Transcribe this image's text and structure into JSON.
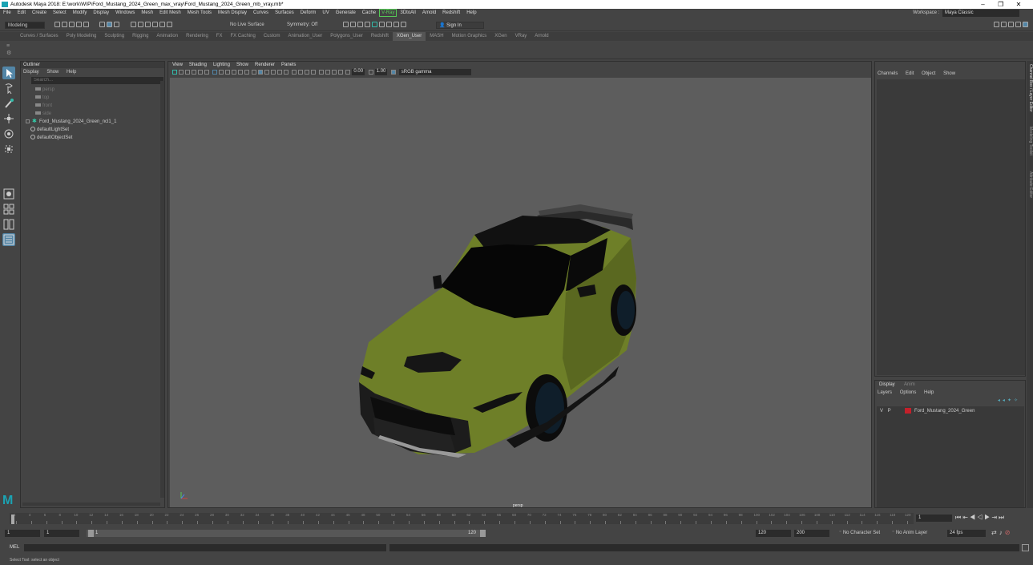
{
  "window": {
    "title": "Autodesk Maya 2018: E:\\work\\WIP\\Ford_Mustang_2024_Green_max_vray\\Ford_Mustang_2024_Green_mb_vray.mb*",
    "minimize": "–",
    "maximize": "❐",
    "close": "✕"
  },
  "menubar": {
    "items": [
      "File",
      "Edit",
      "Create",
      "Select",
      "Modify",
      "Display",
      "Windows",
      "Mesh",
      "Edit Mesh",
      "Mesh Tools",
      "Mesh Display",
      "Curves",
      "Surfaces",
      "Deform",
      "UV",
      "Generate",
      "Cache",
      "V-Ray",
      "3DtoAll",
      "Arnold",
      "Redshift",
      "Help"
    ],
    "workspace_label": "Workspace :",
    "workspace_value": "Maya Classic"
  },
  "statusline": {
    "mode": "Modeling",
    "live_surface": "No Live Surface",
    "symmetry": "Symmetry: Off",
    "sign_in": "Sign In"
  },
  "shelf": {
    "tabs": [
      "Curves / Surfaces",
      "Poly Modeling",
      "Sculpting",
      "Rigging",
      "Animation",
      "Rendering",
      "FX",
      "FX Caching",
      "Custom",
      "Animation_User",
      "Polygons_User",
      "Redshift",
      "XGen_User",
      "MASH",
      "Motion Graphics",
      "XGen",
      "VRay",
      "Arnold"
    ],
    "active_tab": "XGen_User"
  },
  "outliner": {
    "title": "Outliner",
    "menu": [
      "Display",
      "Show",
      "Help"
    ],
    "search_placeholder": "Search...",
    "items": [
      {
        "label": "persp",
        "type": "camera",
        "dim": true
      },
      {
        "label": "top",
        "type": "camera",
        "dim": true
      },
      {
        "label": "front",
        "type": "camera",
        "dim": true
      },
      {
        "label": "side",
        "type": "camera",
        "dim": true
      },
      {
        "label": "Ford_Mustang_2024_Green_ncl1_1",
        "type": "group",
        "dim": false
      },
      {
        "label": "defaultLightSet",
        "type": "set",
        "dim": false
      },
      {
        "label": "defaultObjectSet",
        "type": "set",
        "dim": false
      }
    ]
  },
  "viewport": {
    "menu": [
      "View",
      "Shading",
      "Lighting",
      "Show",
      "Renderer",
      "Panels"
    ],
    "exposure": "0.00",
    "gamma": "1.00",
    "color_space": "sRGB gamma",
    "camera_label": "persp",
    "model_color": "#6e7f28"
  },
  "channel_box": {
    "menu": [
      "Channels",
      "Edit",
      "Object",
      "Show"
    ]
  },
  "layer_editor": {
    "tabs": [
      "Display",
      "Anim"
    ],
    "menu": [
      "Layers",
      "Options",
      "Help"
    ],
    "layer": {
      "v": "V",
      "p": "P",
      "name": "Ford_Mustang_2024_Green",
      "color": "#c3202a"
    }
  },
  "side_tabs": [
    "Channel Box / Layer Editor",
    "Modeling Toolkit",
    "Attribute Editor"
  ],
  "timeline": {
    "ticks": [
      "1",
      "4",
      "6",
      "8",
      "10",
      "12",
      "14",
      "16",
      "18",
      "20",
      "22",
      "24",
      "26",
      "28",
      "30",
      "32",
      "34",
      "36",
      "38",
      "40",
      "42",
      "44",
      "46",
      "48",
      "50",
      "52",
      "54",
      "56",
      "58",
      "60",
      "62",
      "64",
      "66",
      "68",
      "70",
      "72",
      "74",
      "76",
      "78",
      "80",
      "82",
      "84",
      "86",
      "88",
      "90",
      "92",
      "94",
      "96",
      "98",
      "100",
      "102",
      "104",
      "106",
      "108",
      "110",
      "112",
      "114",
      "116",
      "118",
      "120"
    ],
    "current_frame": "1"
  },
  "range": {
    "start": "1",
    "playback_start": "1",
    "slider_start": "1",
    "slider_end": "120",
    "playback_end": "120",
    "end": "200",
    "character_set": "No Character Set",
    "anim_layer": "No Anim Layer",
    "fps": "24 fps"
  },
  "command_line": {
    "lang": "MEL"
  },
  "help_line": {
    "text": "Select Tool: select an object"
  }
}
